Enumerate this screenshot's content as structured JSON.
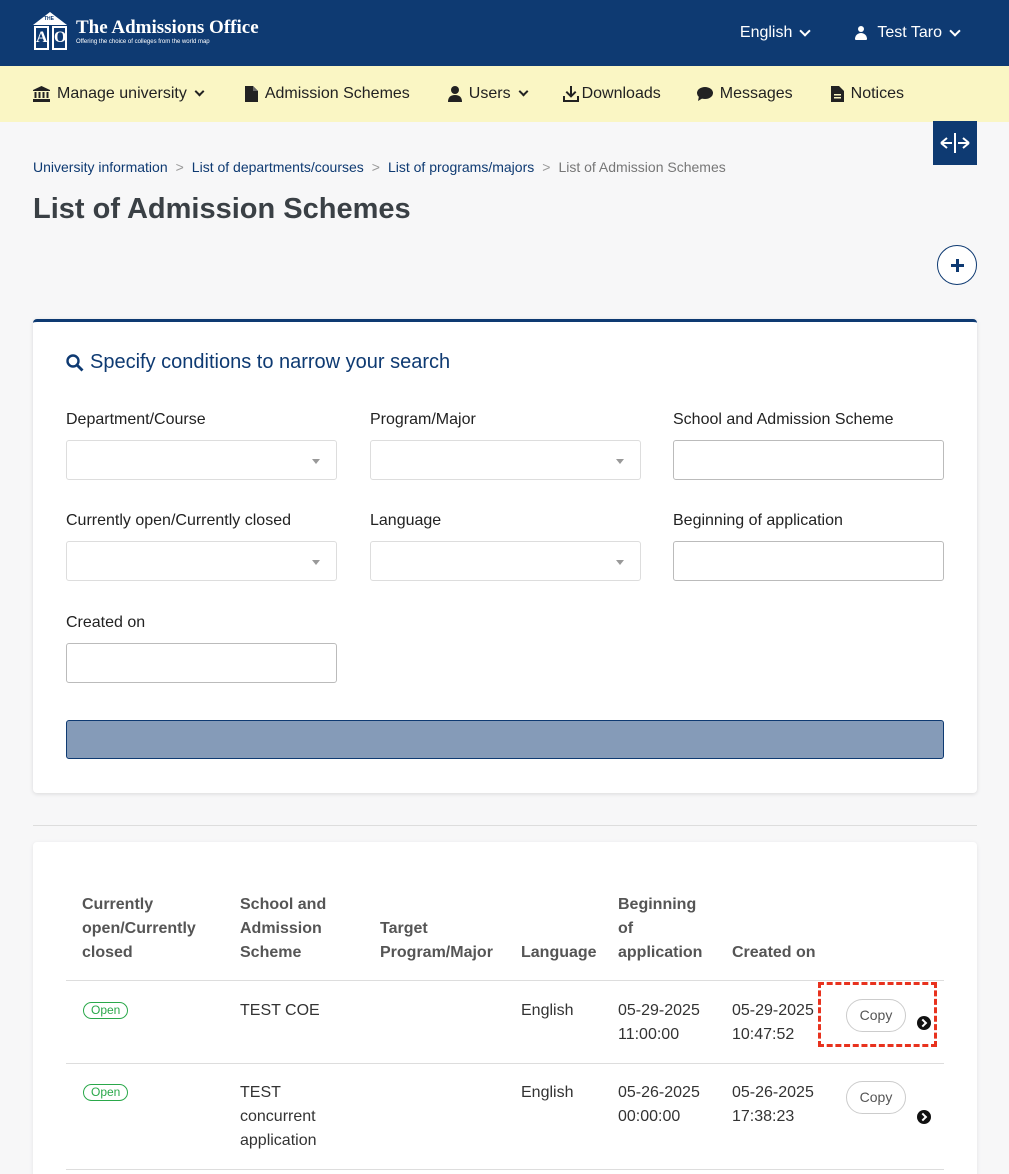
{
  "header": {
    "logo_title": "The Admissions Office",
    "logo_tagline": "Offering the choice of colleges from the world map",
    "logo_letters": [
      "A",
      "O"
    ],
    "language": "English",
    "user_name": "Test Taro"
  },
  "nav": {
    "items": [
      {
        "label": "Manage university",
        "icon": "university-icon",
        "dropdown": true
      },
      {
        "label": "Admission Schemes",
        "icon": "file-icon",
        "dropdown": false
      },
      {
        "label": "Users",
        "icon": "user-icon",
        "dropdown": true
      },
      {
        "label": "Downloads",
        "icon": "download-icon",
        "dropdown": false
      },
      {
        "label": "Messages",
        "icon": "comment-icon",
        "dropdown": false
      },
      {
        "label": "Notices",
        "icon": "document-icon",
        "dropdown": false
      }
    ]
  },
  "breadcrumb": {
    "items": [
      "University information",
      "List of departments/courses",
      "List of programs/majors"
    ],
    "current": "List of Admission Schemes",
    "separator": ">"
  },
  "page_title": "List of Admission Schemes",
  "search": {
    "title": "Specify conditions to narrow your search",
    "fields": {
      "department": "Department/Course",
      "program": "Program/Major",
      "school_scheme": "School and Admission Scheme",
      "open_closed": "Currently open/Currently closed",
      "language": "Language",
      "beginning": "Beginning of application",
      "created_on": "Created on"
    },
    "values": {
      "school_scheme": "",
      "beginning": "",
      "created_on": ""
    }
  },
  "table": {
    "headers": {
      "status": "Currently open/Currently closed",
      "scheme": "School and Admission Scheme",
      "target": "Target Program/Major",
      "language": "Language",
      "beginning": "Beginning of application",
      "created": "Created on"
    },
    "rows": [
      {
        "status": "Open",
        "scheme": "TEST COE",
        "target": "",
        "language": "English",
        "beginning_date": "05-29-2025",
        "beginning_time": "11:00:00",
        "created_date": "05-29-2025",
        "created_time": "10:47:52",
        "copy": "Copy"
      },
      {
        "status": "Open",
        "scheme": "TEST concurrent application",
        "target": "",
        "language": "English",
        "beginning_date": "05-26-2025",
        "beginning_time": "00:00:00",
        "created_date": "05-26-2025",
        "created_time": "17:38:23",
        "copy": "Copy"
      }
    ]
  },
  "colors": {
    "primary": "#0e3a72",
    "nav_bg": "#faf6c4",
    "open_badge": "#2aa84a",
    "highlight": "#e8321e"
  }
}
